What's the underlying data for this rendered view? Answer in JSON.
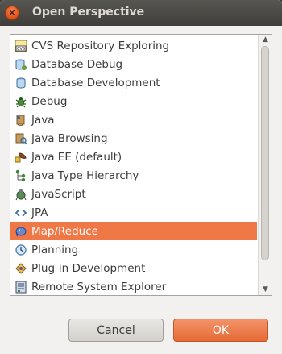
{
  "window": {
    "title": "Open Perspective"
  },
  "list": {
    "selected_index": 10,
    "items": [
      {
        "label": "CVS Repository Exploring",
        "icon": "cvs-icon"
      },
      {
        "label": "Database Debug",
        "icon": "database-debug-icon"
      },
      {
        "label": "Database Development",
        "icon": "database-development-icon"
      },
      {
        "label": "Debug",
        "icon": "debug-bug-icon"
      },
      {
        "label": "Java",
        "icon": "java-icon"
      },
      {
        "label": "Java Browsing",
        "icon": "java-browsing-icon"
      },
      {
        "label": "Java EE (default)",
        "icon": "java-ee-icon"
      },
      {
        "label": "Java Type Hierarchy",
        "icon": "type-hierarchy-icon"
      },
      {
        "label": "JavaScript",
        "icon": "javascript-icon"
      },
      {
        "label": "JPA",
        "icon": "jpa-icon"
      },
      {
        "label": "Map/Reduce",
        "icon": "map-reduce-elephant-icon"
      },
      {
        "label": "Planning",
        "icon": "planning-clock-icon"
      },
      {
        "label": "Plug-in Development",
        "icon": "plugin-development-icon"
      },
      {
        "label": "Remote System Explorer",
        "icon": "remote-system-explorer-icon"
      }
    ]
  },
  "buttons": {
    "cancel": "Cancel",
    "ok": "OK"
  },
  "colors": {
    "selection": "#f07746",
    "ok_button": "#e66a35",
    "close_button": "#e0561c"
  }
}
